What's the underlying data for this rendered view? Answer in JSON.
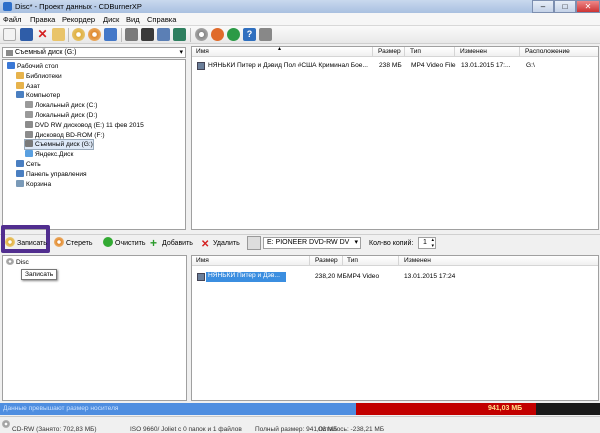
{
  "window": {
    "title": "Disc* - Проект данных - CDBurnerXP",
    "controls": {
      "minimize": "–",
      "maximize": "□",
      "close": "✕"
    }
  },
  "menu": [
    "Файл",
    "Правка",
    "Рекордер",
    "Диск",
    "Вид",
    "Справка"
  ],
  "explorer": {
    "drive_combo": "Съемный диск (G:)",
    "tree": [
      {
        "label": "Рабочий стол",
        "level": 0,
        "icon": "desktop-icon",
        "color": "#3a78d6"
      },
      {
        "label": "Библиотеки",
        "level": 1,
        "icon": "library-icon",
        "color": "#e7b34c"
      },
      {
        "label": "Азат",
        "level": 1,
        "icon": "user-folder-icon",
        "color": "#e7b34c"
      },
      {
        "label": "Компьютер",
        "level": 1,
        "icon": "computer-icon",
        "color": "#4a7fc1"
      },
      {
        "label": "Локальный диск (C:)",
        "level": 2,
        "icon": "hard-disk-icon",
        "color": "#9a9a9a"
      },
      {
        "label": "Локальный диск (D:)",
        "level": 2,
        "icon": "hard-disk-icon",
        "color": "#9a9a9a"
      },
      {
        "label": "DVD RW дисковод (E:) 11 фев 2015",
        "level": 2,
        "icon": "dvd-drive-icon",
        "color": "#8c8c8c"
      },
      {
        "label": "Дисковод BD-ROM (F:)",
        "level": 2,
        "icon": "bd-drive-icon",
        "color": "#8c8c8c"
      },
      {
        "label": "Съемный диск (G:)",
        "level": 2,
        "icon": "removable-disk-icon",
        "color": "#7a7a7a",
        "selected": true
      },
      {
        "label": "Яндекс.Диск",
        "level": 2,
        "icon": "yandex-disk-icon",
        "color": "#5aa0e0"
      },
      {
        "label": "Сеть",
        "level": 1,
        "icon": "network-icon",
        "color": "#4a7fc1"
      },
      {
        "label": "Панель управления",
        "level": 1,
        "icon": "control-panel-icon",
        "color": "#4a7fc1"
      },
      {
        "label": "Корзина",
        "level": 1,
        "icon": "recycle-bin-icon",
        "color": "#7a9ab8"
      }
    ],
    "file_columns": [
      "Имя",
      "Размер",
      "Тип",
      "Изменен",
      "Расположение"
    ],
    "files": [
      {
        "name": "НЯНЬКИ Питер и Дэвид Пол #США Криминал Бое...",
        "size": "238 МБ",
        "type": "MP4 Video File",
        "modified": "13.01.2015 17:...",
        "location": "G:\\"
      }
    ]
  },
  "actions": {
    "burn": "Записать",
    "erase": "Стереть",
    "clean": "Очистить",
    "add": "Добавить",
    "delete": "Удалить",
    "drive_select": "E: PIONEER DVD-RW  DV",
    "copies_label": "Кол-во копий:",
    "copies_value": "1",
    "tooltip": "Записать"
  },
  "disc": {
    "root_label": "Disc",
    "columns": [
      "Имя",
      "Размер",
      "Тип",
      "Изменен"
    ],
    "files": [
      {
        "name": "НЯНЬКИ Питер и Дэв...",
        "size": "238,20 МБ",
        "type": "MP4 Video",
        "modified": "13.01.2015 17:24"
      }
    ]
  },
  "capacity": {
    "warning": "Данные превышают размер носителя",
    "total": "941,03 МБ",
    "used_fraction": 0.665,
    "colors": {
      "normal": "#4f8ee0",
      "over": "#c20000",
      "marker": "#1a1a1a"
    }
  },
  "status": {
    "drive": "CD-RW (Занято: 702,83 МБ)",
    "fs": "ISO 9660/ Joliet с 0 папок и 1 файлов",
    "full": "Полный размер: 941,03 МБ",
    "remaining": "Осталось: -238,21 МБ"
  },
  "colors": {
    "highlight": "#512e8f",
    "selection": "#3b8ee0"
  }
}
